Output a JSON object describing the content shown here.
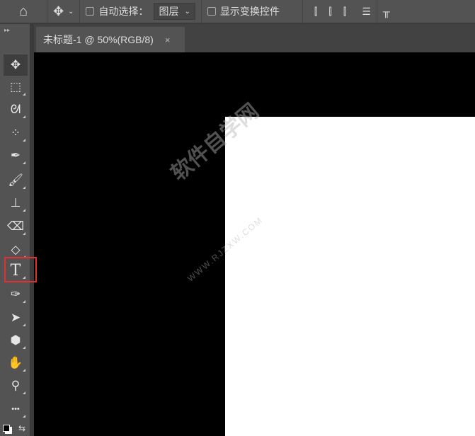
{
  "options_bar": {
    "auto_select_label": "自动选择：",
    "auto_select_value": "图层",
    "show_transform_label": "显示变换控件"
  },
  "document_tab": {
    "title": "未标题-1 @ 50%(RGB/8)",
    "close": "×"
  },
  "tools": [
    {
      "name": "move-tool",
      "glyph": "✥"
    },
    {
      "name": "marquee-tool",
      "glyph": "⬚"
    },
    {
      "name": "lasso-tool",
      "glyph": "ᘛ"
    },
    {
      "name": "quick-select-tool",
      "glyph": "⁘"
    },
    {
      "name": "eyedropper-tool",
      "glyph": "✒"
    },
    {
      "name": "brush-tool",
      "glyph": "🖌"
    },
    {
      "name": "stamp-tool",
      "glyph": "⊥"
    },
    {
      "name": "eraser-tool",
      "glyph": "⌫"
    },
    {
      "name": "paint-bucket-tool",
      "glyph": "◇"
    },
    {
      "name": "type-tool",
      "glyph": "T"
    },
    {
      "name": "pen-tool",
      "glyph": "✑"
    },
    {
      "name": "path-select-tool",
      "glyph": "➤"
    },
    {
      "name": "shape-tool",
      "glyph": "⬢"
    },
    {
      "name": "hand-tool",
      "glyph": "✋"
    },
    {
      "name": "zoom-tool",
      "glyph": "⚲"
    },
    {
      "name": "more-tools",
      "glyph": "•••"
    }
  ],
  "watermark": {
    "text": "软件自学网",
    "url": "WWW.RJZXW.COM"
  }
}
